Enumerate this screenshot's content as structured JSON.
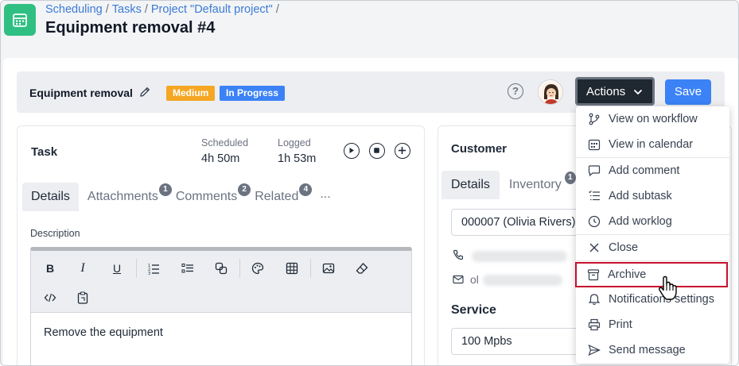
{
  "breadcrumb": [
    "Scheduling",
    "Tasks",
    "Project \"Default project\""
  ],
  "breadcrumb_sep": "/",
  "page_title": "Equipment removal #4",
  "task_bar": {
    "title": "Equipment removal",
    "badge_priority": "Medium",
    "badge_status": "In Progress",
    "help": "?",
    "actions_label": "Actions",
    "save_label": "Save"
  },
  "colors": {
    "brand": "#2fbf82",
    "medium": "#f5a623",
    "in_progress": "#3b82f6",
    "actions": "#1f2730",
    "save": "#3b82f6",
    "highlight": "#c8102e"
  },
  "task_panel": {
    "title": "Task",
    "scheduled_label": "Scheduled",
    "scheduled_value": "4h 50m",
    "logged_label": "Logged",
    "logged_value": "1h 53m",
    "tabs": [
      {
        "label": "Details",
        "count": ""
      },
      {
        "label": "Attachments",
        "count": "1"
      },
      {
        "label": "Comments",
        "count": "2"
      },
      {
        "label": "Related",
        "count": "4"
      }
    ],
    "more": "...",
    "description_label": "Description",
    "description_text": "Remove the equipment",
    "toolbar_icons": [
      "bold-icon",
      "italic-icon",
      "underline-icon",
      "ordered-list-icon",
      "bullet-list-icon",
      "copy-icon",
      "palette-icon",
      "table-icon",
      "image-icon",
      "eraser-icon",
      "code-icon",
      "clipboard-icon"
    ]
  },
  "customer_panel": {
    "title": "Customer",
    "tabs": [
      {
        "label": "Details",
        "count": ""
      },
      {
        "label": "Inventory",
        "count": "1"
      }
    ],
    "customer_value": "000007 (Olivia Rivers)",
    "email_prefix": "ol",
    "service_label": "Service",
    "service_value": "100 Mpbs"
  },
  "menu": {
    "items": [
      {
        "label": "View on workflow",
        "icon": "workflow-icon"
      },
      {
        "label": "View in calendar",
        "icon": "calendar-icon"
      },
      {
        "label": "Add comment",
        "icon": "comment-icon"
      },
      {
        "label": "Add subtask",
        "icon": "subtask-icon"
      },
      {
        "label": "Add worklog",
        "icon": "clock-icon"
      },
      {
        "label": "Close",
        "icon": "close-icon"
      },
      {
        "label": "Archive",
        "icon": "archive-icon"
      },
      {
        "label": "Notifications settings",
        "icon": "bell-icon"
      },
      {
        "label": "Print",
        "icon": "printer-icon"
      },
      {
        "label": "Send message",
        "icon": "send-icon"
      }
    ]
  }
}
